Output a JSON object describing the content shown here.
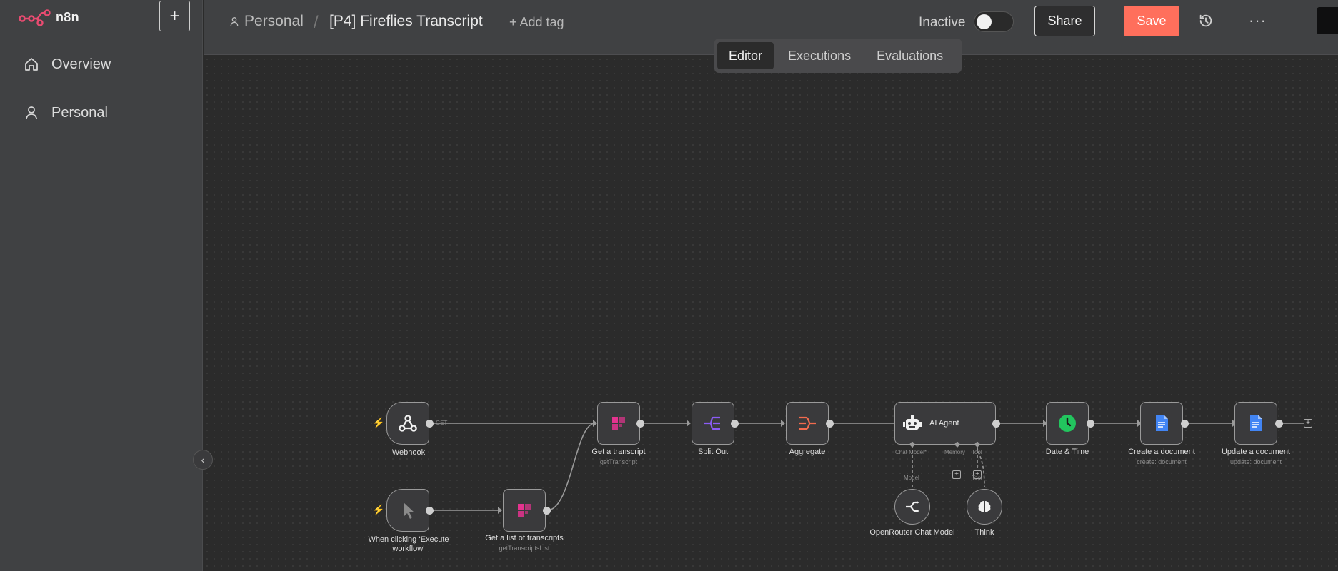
{
  "app": {
    "name": "n8n"
  },
  "sidebar": {
    "new_button": "+",
    "items": [
      {
        "label": "Overview",
        "icon": "home-icon"
      },
      {
        "label": "Personal",
        "icon": "user-icon"
      }
    ],
    "collapse_icon": "‹"
  },
  "header": {
    "project": "Personal",
    "separator": "/",
    "workflow_title": "[P4] Fireflies Transcript",
    "add_tag": "+ Add tag",
    "status_label": "Inactive",
    "active": false,
    "share_label": "Share",
    "save_label": "Save",
    "more_label": "···"
  },
  "tabs": [
    {
      "label": "Editor",
      "active": true
    },
    {
      "label": "Executions",
      "active": false
    },
    {
      "label": "Evaluations",
      "active": false
    }
  ],
  "colors": {
    "accent": "#ff6f5c",
    "fireflies": "#e5338f",
    "split": "#8b5cf6",
    "aggregate": "#f26b4e",
    "datetime": "#22c55e",
    "gdocs": "#4285f4"
  },
  "nodes": {
    "webhook": {
      "label": "Webhook",
      "port_label": "GET",
      "icon": "webhook-icon"
    },
    "manual": {
      "label": "When clicking ‘Execute workflow’",
      "icon": "cursor-icon"
    },
    "get_list": {
      "label": "Get a list of transcripts",
      "sub": "getTranscriptsList",
      "icon": "fireflies-icon"
    },
    "get_transcript": {
      "label": "Get a transcript",
      "sub": "getTranscript",
      "icon": "fireflies-icon"
    },
    "split_out": {
      "label": "Split Out",
      "icon": "split-icon"
    },
    "aggregate": {
      "label": "Aggregate",
      "icon": "aggregate-icon"
    },
    "ai_agent": {
      "label": "AI Agent",
      "icon": "robot-icon",
      "ports": {
        "chat_model": "Chat Model*",
        "memory": "Memory",
        "tool": "Tool"
      }
    },
    "openrouter": {
      "label": "OpenRouter Chat Model",
      "port_label": "Model",
      "icon": "openrouter-icon"
    },
    "think": {
      "label": "Think",
      "port_label": "Tool",
      "icon": "brain-icon"
    },
    "date_time": {
      "label": "Date & Time",
      "icon": "clock-icon"
    },
    "create_doc": {
      "label": "Create a document",
      "sub": "create: document",
      "icon": "gdocs-icon"
    },
    "update_doc": {
      "label": "Update a document",
      "sub": "update: document",
      "icon": "gdocs-icon"
    }
  }
}
